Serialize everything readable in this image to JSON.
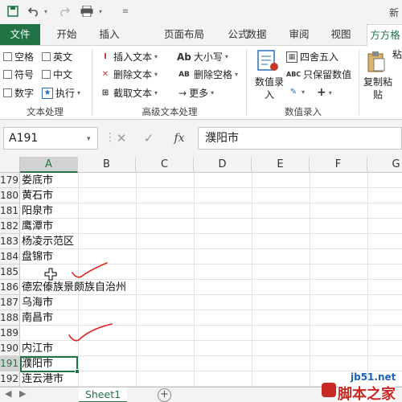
{
  "title_bar": {
    "right_text": "新"
  },
  "tabs": [
    "文件",
    "开始",
    "插入",
    "页面布局",
    "公式",
    "数据",
    "审阅",
    "视图",
    "方方格"
  ],
  "ribbon": {
    "text_processing": {
      "items": [
        "空格",
        "英文",
        "符号",
        "中文",
        "数字",
        "执行"
      ],
      "group_label": "文本处理"
    },
    "advanced_text": {
      "items": [
        "插入文本",
        "大小写",
        "删除文本",
        "删除空格",
        "截取文本",
        "更多"
      ],
      "prefix_ab": "Ab",
      "group_label": "高级文本处理"
    },
    "numeric_entry": {
      "big_button": "数值录入",
      "items": [
        "四舍五入",
        "只保留数值"
      ],
      "abc": "ABC",
      "group_label": "数值录入"
    },
    "paste": {
      "label": "复制粘贴",
      "extra": "粘"
    }
  },
  "formula_bar": {
    "name_box": "A191",
    "fx": "fx",
    "cancel": "✕",
    "confirm": "✓",
    "content": "濮阳市"
  },
  "columns": [
    "A",
    "B",
    "C",
    "D",
    "E",
    "F",
    "G"
  ],
  "rows": [
    {
      "num": "179",
      "value": "娄底市"
    },
    {
      "num": "180",
      "value": "黄石市"
    },
    {
      "num": "181",
      "value": "阳泉市"
    },
    {
      "num": "182",
      "value": "鹰潭市"
    },
    {
      "num": "183",
      "value": "杨凌示范区"
    },
    {
      "num": "184",
      "value": "盘锦市"
    },
    {
      "num": "185",
      "value": ""
    },
    {
      "num": "186",
      "value": "德宏傣族景颇族自治州"
    },
    {
      "num": "187",
      "value": "乌海市"
    },
    {
      "num": "188",
      "value": "南昌市"
    },
    {
      "num": "189",
      "value": ""
    },
    {
      "num": "190",
      "value": "内江市"
    },
    {
      "num": "191",
      "value": "濮阳市"
    },
    {
      "num": "192",
      "value": "连云港市"
    }
  ],
  "sheet_tabs": {
    "sheet": "Sheet1",
    "add": "+"
  },
  "watermark": {
    "url": "jb51.net",
    "name": "脚本之家"
  },
  "colors": {
    "excel_green": "#217346",
    "annotation_red": "#d9261c"
  }
}
